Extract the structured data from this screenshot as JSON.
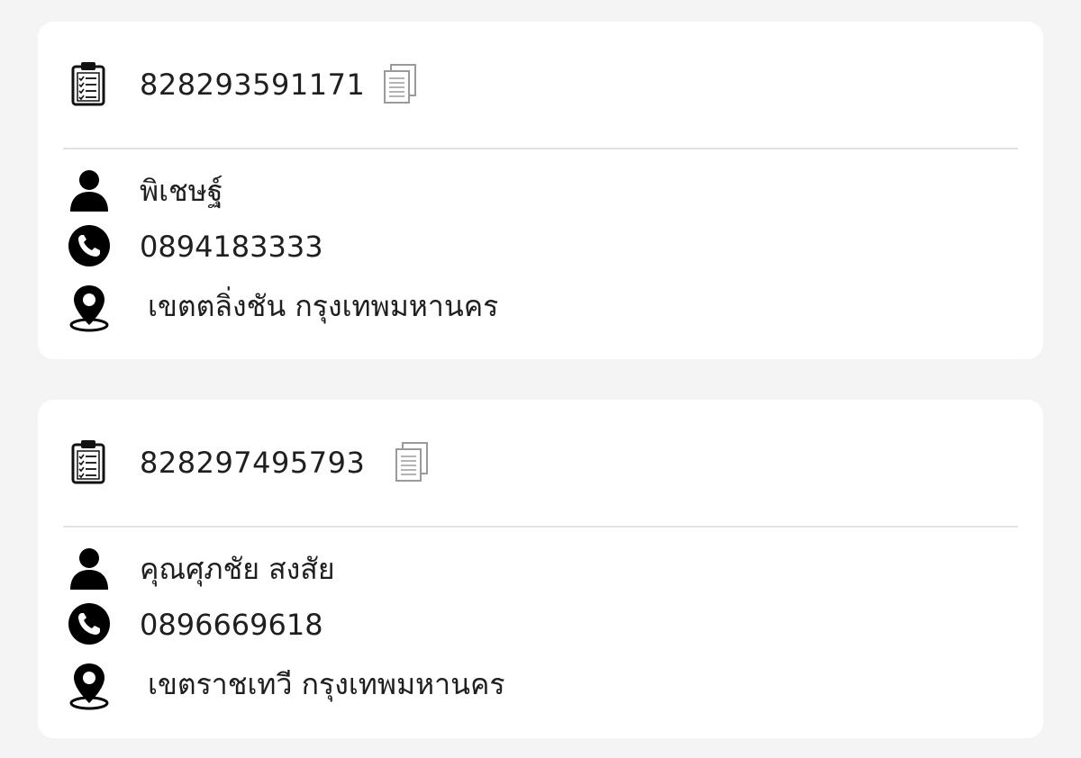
{
  "orders": [
    {
      "tracking_number": "828293591171",
      "customer_name": "พิเชษฐ์",
      "phone": "0894183333",
      "location": "เขตตลิ่งชัน กรุงเทพมหานคร"
    },
    {
      "tracking_number": "828297495793",
      "customer_name": "คุณศุภชัย สงสัย",
      "phone": "0896669618",
      "location": "เขตราชเทวี กรุงเทพมหานคร"
    }
  ],
  "icons": {
    "order": "clipboard-checklist-icon",
    "copy": "copy-documents-icon",
    "name": "user-icon",
    "phone": "phone-icon",
    "location": "map-pin-icon"
  },
  "colors": {
    "background": "#f4f4f4",
    "card": "#ffffff",
    "text": "#1f1f1f",
    "divider": "#e2e2e2",
    "copy_icon": "#9a9a9a"
  }
}
